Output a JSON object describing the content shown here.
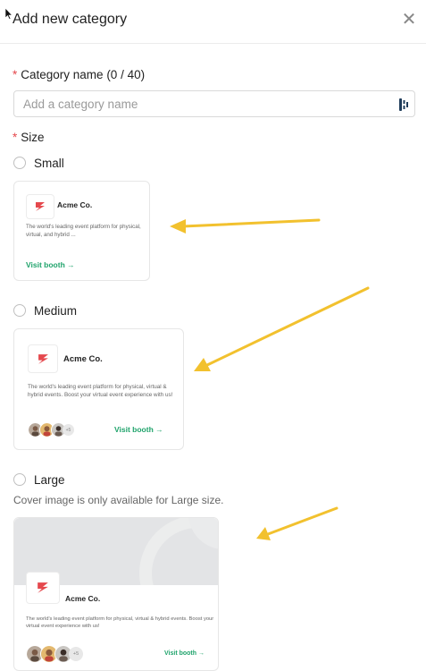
{
  "header": {
    "title": "Add new category",
    "close_glyph": "✕"
  },
  "form": {
    "name_label": "Category name (0 / 40)",
    "name_placeholder": "Add a category name",
    "name_value": "",
    "required_mark": "*",
    "size_label": "Size",
    "size_options": [
      {
        "label": "Small",
        "selected": false
      },
      {
        "label": "Medium",
        "selected": false
      },
      {
        "label": "Large",
        "selected": false
      }
    ],
    "large_note": "Cover image is only available for Large size."
  },
  "cards": {
    "small": {
      "brand": "Acme Co.",
      "desc": "The world's leading event platform for physical, virtual, and hybrid ...",
      "visit": "Visit booth →"
    },
    "medium": {
      "brand": "Acme Co.",
      "desc": "The world's leading event platform for physical, virtual & hybrid events. Boost your virtual event experience with us!",
      "visit": "Visit booth →",
      "more": "+5"
    },
    "large": {
      "brand": "Acme Co.",
      "desc": "The world's leading event platform for physical, virtual & hybrid events. Boost your virtual event experience with us!",
      "visit": "Visit booth →",
      "more": "+5"
    }
  },
  "colors": {
    "accent_green": "#1fa36b",
    "brand_red": "#e5484d",
    "annotation_arrow": "#f2c12e"
  }
}
